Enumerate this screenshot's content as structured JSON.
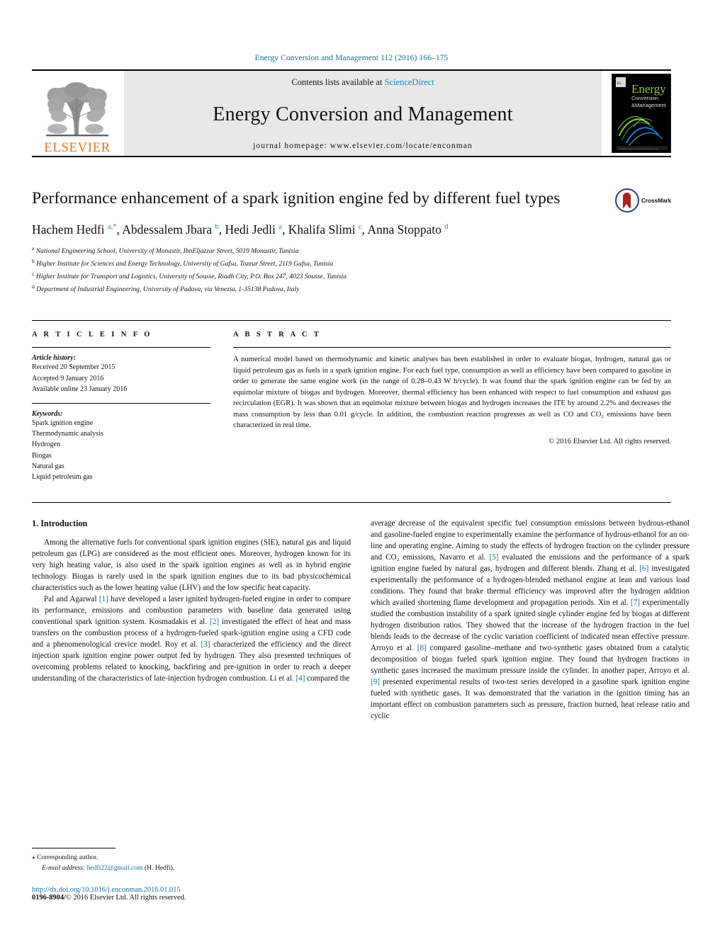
{
  "running_head": "Energy Conversion and Management 112 (2016) 166–175",
  "masthead": {
    "publisher_name": "ELSEVIER",
    "contents_prefix": "Contents lists available at ",
    "sciencedirect": "ScienceDirect",
    "journal_title": "Energy Conversion and Management",
    "homepage": "journal homepage: www.elsevier.com/locate/enconman",
    "cover": {
      "line1": "Energy",
      "line2": "Conversion",
      "line3": "&Management"
    }
  },
  "article": {
    "title": "Performance enhancement of a spark ignition engine fed by different fuel types",
    "crossmark_label": "CrossMark",
    "authors_html": "Hachem Hedfi <sup>a,*</sup>, Abdessalem Jbara <sup>b</sup>, Hedi Jedli <sup>a</sup>, Khalifa Slimi <sup>c</sup>, Anna Stoppato <sup>d</sup>",
    "affiliations": [
      {
        "marker": "a",
        "text": "National Engineering School, University of Monastir, IbnEljazzar Street, 5019 Monastir, Tunisia"
      },
      {
        "marker": "b",
        "text": "Higher Institute for Sciences and Energy Technology, University of Gafsa, Tozeur Street, 2119 Gafsa, Tunisia"
      },
      {
        "marker": "c",
        "text": "Higher Institute for Transport and Logistics, University of Sousse, Riadh City, P.O. Box 247, 4023 Sousse, Tunisia"
      },
      {
        "marker": "d",
        "text": "Department of Industrial Engineering, University of Padova, via Venezia, 1-35138 Padova, Italy"
      }
    ]
  },
  "article_info": {
    "heading": "A R T I C L E    I N F O",
    "history_label": "Article history:",
    "history": [
      "Received 20 September 2015",
      "Accepted 9 January 2016",
      "Available online 23 January 2016"
    ],
    "keywords_label": "Keywords:",
    "keywords": [
      "Spark ignition engine",
      "Thermodynamic analysis",
      "Hydrogen",
      "Biogas",
      "Natural gas",
      "Liquid petroleum gas"
    ]
  },
  "abstract": {
    "heading": "A B S T R A C T",
    "text": "A numerical model based on thermodynamic and kinetic analyses has been established in order to evaluate biogas, hydrogen, natural gas or liquid petroleum gas as fuels in a spark ignition engine. For each fuel type, consumption as well as efficiency have been compared to gasoline in order to generate the same engine work (in the range of 0.28–0.43 W h/cycle). It was found that the spark ignition engine can be fed by an equimolar mixture of biogas and hydrogen. Moreover, thermal efficiency has been enhanced with respect to fuel consumption and exhaust gas recirculation (EGR). It was shown that an equimolar mixture between biogas and hydrogen increases the ITE by around 2.2% and decreases the mass consumption by less than 0.01 g/cycle. In addition, the combustion reaction progresses as well as CO and CO₂ emissions have been characterized in real time.",
    "copyright": "© 2016 Elsevier Ltd. All rights reserved."
  },
  "body": {
    "section_number_title": "1. Introduction",
    "left_paragraphs": [
      "Among the alternative fuels for conventional spark ignition engines (SIE), natural gas and liquid petroleum gas (LPG) are considered as the most efficient ones. Moreover, hydrogen known for its very high heating value, is also used in the spark ignition engines as well as in hybrid engine technology. Biogas is rarely used in the spark ignition engines due to its bad physicochemical characteristics such as the lower heating value (LHV) and the low specific heat capacity.",
      "Pal and Agarwal [1] have developed a laser ignited hydrogen-fueled engine in order to compare its performance, emissions and combustion parameters with baseline data generated using conventional spark ignition system. Kosmadakis et al. [2] investigated the effect of heat and mass transfers on the combustion process of a hydrogen-fueled spark-ignition engine using a CFD code and a phenomenological crevice model. Roy et al. [3] characterized the efficiency and the direct injection spark ignition engine power output fed by hydrogen. They also presented techniques of overcoming problems related to knocking, backfiring and pre-ignition in order to reach a deeper understanding of the characteristics of late-injection hydrogen combustion. Li et al. [4] compared the"
    ],
    "right_paragraphs": [
      "average decrease of the equivalent specific fuel consumption emissions between hydrous-ethanol and gasoline-fueled engine to experimentally examine the performance of hydrous-ethanol for an on-line and operating engine. Aiming to study the effects of hydrogen fraction on the cylinder pressure and CO₂ emissions, Navarro et al. [5] evaluated the emissions and the performance of a spark ignition engine fueled by natural gas, hydrogen and different blends. Zhang et al. [6] investigated experimentally the performance of a hydrogen-blended methanol engine at lean and various load conditions. They found that brake thermal efficiency was improved after the hydrogen addition which availed shortening flame development and propagation periods. Xin et al. [7] experimentally studied the combustion instability of a spark ignited single cylinder engine fed by biogas at different hydrogen distribution ratios. They showed that the increase of the hydrogen fraction in the fuel blends leads to the decrease of the cyclic variation coefficient of indicated mean effective pressure. Arroyo et al. [8] compared gasoline–methane and two-synthetic gases obtained from a catalytic decomposition of biogas fueled spark ignition engine. They found that hydrogen fractions in synthetic gases increased the maximum pressure inside the cylinder. In another paper, Arroyo et al. [9] presented experimental results of two-test series developed in a gasoline spark ignition engine fueled with synthetic gases. It was demonstrated that the variation in the ignition timing has an important effect on combustion parameters such as pressure, fraction burned, heat release ratio and cyclic"
    ]
  },
  "footer": {
    "corresponding_marker": "⁎",
    "corresponding_label": "Corresponding author.",
    "email_label": "E-mail address:",
    "email": "hedfi22@gmail.com",
    "email_suffix": "(H. Hedfi).",
    "doi": "http://dx.doi.org/10.1016/j.enconman.2016.01.015",
    "issn": "0196-8904/",
    "issn_rights": "© 2016 Elsevier Ltd. All rights reserved."
  },
  "colors": {
    "link_blue": "#1a6d9e",
    "sciencedirect_blue": "#1a86c8",
    "elsevier_orange": "#e87722",
    "banner_gray": "#e8e8e8"
  }
}
